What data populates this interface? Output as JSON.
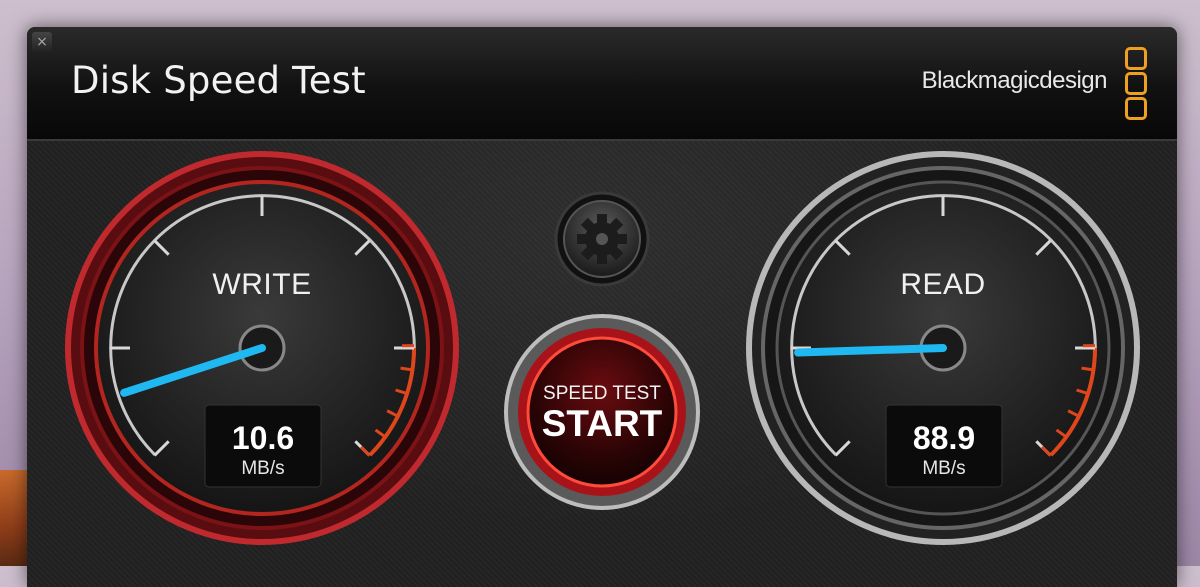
{
  "window": {
    "title": "Disk Speed Test",
    "close_label": "×"
  },
  "brand": {
    "name": "Blackmagicdesign",
    "logo_icon": "blackmagic-logo-icon",
    "accent": "#f0a020"
  },
  "write_gauge": {
    "label": "WRITE",
    "value": "10.6",
    "unit": "MB/s",
    "needle_fraction": 0.1,
    "ring_color": "#a01e22",
    "needle_color": "#1fb8f0"
  },
  "read_gauge": {
    "label": "READ",
    "value": "88.9",
    "unit": "MB/s",
    "needle_fraction": 0.16,
    "ring_color": "#9a9a9a",
    "needle_color": "#1fb8f0"
  },
  "start_button": {
    "line1": "SPEED TEST",
    "line2": "START",
    "color": "#b3141a"
  },
  "settings_button": {
    "icon": "gear-icon"
  }
}
